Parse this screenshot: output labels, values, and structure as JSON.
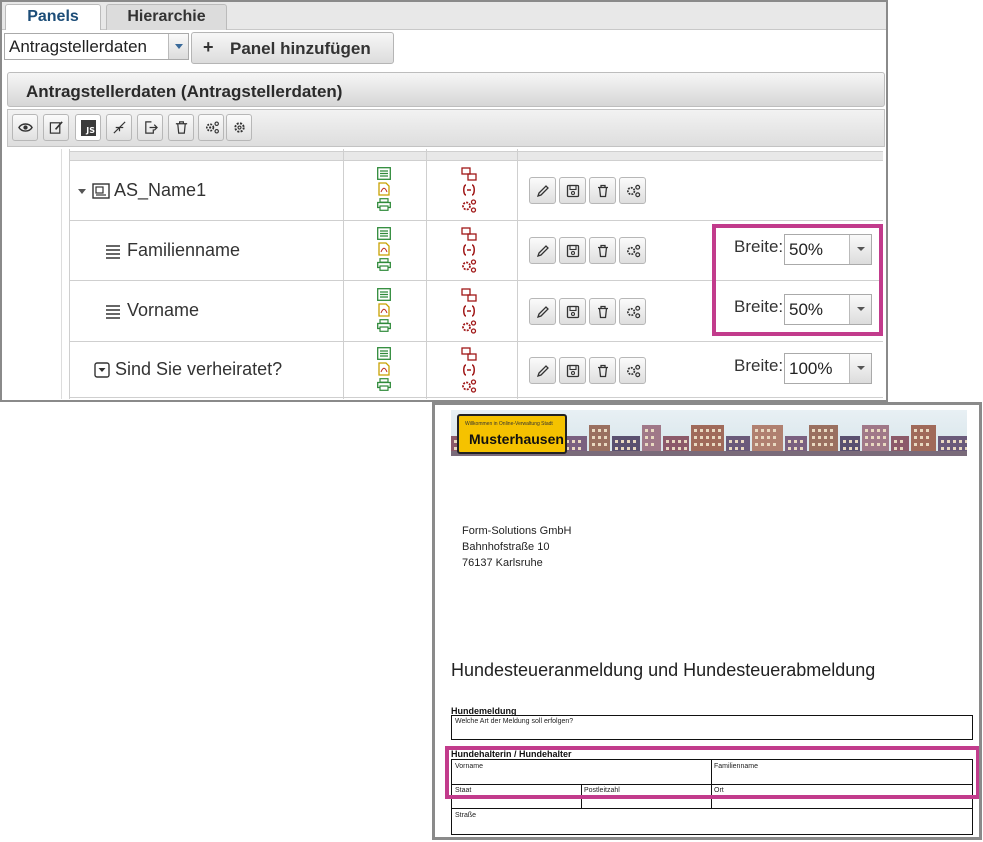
{
  "tabs": {
    "panels": "Panels",
    "hierarchy": "Hierarchie"
  },
  "panel_select": {
    "value": "Antragstellerdaten"
  },
  "add_panel": {
    "plus": "+",
    "label": "Panel hinzufügen"
  },
  "panel_header": {
    "title": "Antragstellerdaten (Antragstellerdaten)"
  },
  "toolbar": {
    "js_label": "JS",
    "icons": [
      "eye-icon",
      "edit-icon",
      "js-icon",
      "collapse-icon",
      "export-icon",
      "trash-icon",
      "cogs-icon",
      "gear-icon"
    ]
  },
  "rows": [
    {
      "label": "AS_Name1",
      "type": "panel",
      "breite": null
    },
    {
      "label": "Familienname",
      "type": "field",
      "breite": "50%"
    },
    {
      "label": "Vorname",
      "type": "field",
      "breite": "50%"
    },
    {
      "label": "Sind Sie verheiratet?",
      "type": "dropdown",
      "breite": "100%"
    }
  ],
  "breite_label": "Breite:",
  "colors": {
    "list_icon": "#2f8a3a",
    "pdf_icon": "#c8a100",
    "print_icon": "#2f8a3a",
    "red_icon": "#a01818",
    "highlight": "#c23b8c"
  },
  "document": {
    "sign_small": "Willkommen in Online-Verwaltung Stadt",
    "sign_big": "Musterhausen",
    "address": [
      "Form-Solutions GmbH",
      "Bahnhofstraße 10",
      "76137 Karlsruhe"
    ],
    "title": "Hundesteueranmeldung und Hundesteuerabmeldung",
    "section1": {
      "title": "Hundemeldung",
      "field": "Welche Art der Meldung soll erfolgen?"
    },
    "section2": {
      "title": "Hundehalterin / Hundehalter",
      "vorname": "Vorname",
      "familienname": "Familienname",
      "staat": "Staat",
      "plz": "Postleitzahl",
      "ort": "Ort",
      "strasse": "Straße"
    }
  }
}
